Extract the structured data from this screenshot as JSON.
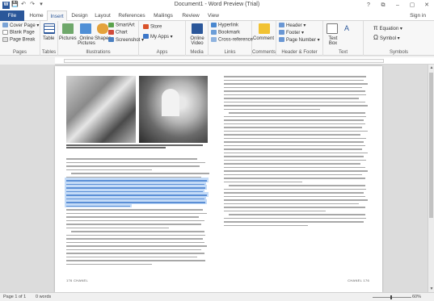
{
  "window": {
    "title": "Document1 - Word Preview (Trial)",
    "icon": "W"
  },
  "window_controls": [
    "?",
    "⧉",
    "–",
    "▢",
    "✕"
  ],
  "qat": [
    "💾",
    "↶",
    "↷",
    "▾"
  ],
  "tabs": [
    "File",
    "Home",
    "Insert",
    "Design",
    "Layout",
    "References",
    "Mailings",
    "Review",
    "View"
  ],
  "signin": "Sign in",
  "ribbon": {
    "pages": {
      "label": "Pages",
      "items": [
        "Cover Page ▾",
        "Blank Page",
        "Page Break"
      ]
    },
    "tables": {
      "label": "Tables",
      "item": "Table"
    },
    "illustrations": {
      "label": "Illustrations",
      "items": [
        "Pictures",
        "Online Pictures",
        "Shapes",
        "SmartArt",
        "Chart",
        "Screenshot ▾"
      ]
    },
    "apps": {
      "label": "Apps",
      "items": [
        "Store",
        "My Apps ▾"
      ]
    },
    "media": {
      "label": "Media",
      "item": "Online Video"
    },
    "links": {
      "label": "Links",
      "items": [
        "Hyperlink",
        "Bookmark",
        "Cross-reference"
      ]
    },
    "comments": {
      "label": "Comments",
      "item": "Comment"
    },
    "header_footer": {
      "label": "Header & Footer",
      "items": [
        "Header ▾",
        "Footer ▾",
        "Page Number ▾"
      ]
    },
    "text": {
      "label": "Text",
      "items": [
        "Text Box",
        "A"
      ]
    },
    "symbols": {
      "label": "Symbols",
      "items": [
        "Equation ▾",
        "Symbol ▾"
      ]
    }
  },
  "document": {
    "footer_left": "176 CHANEL",
    "footer_right": "CHANEL 176"
  },
  "status": {
    "page": "Page 1 of 1",
    "words": "0 words",
    "zoom": "60%"
  }
}
